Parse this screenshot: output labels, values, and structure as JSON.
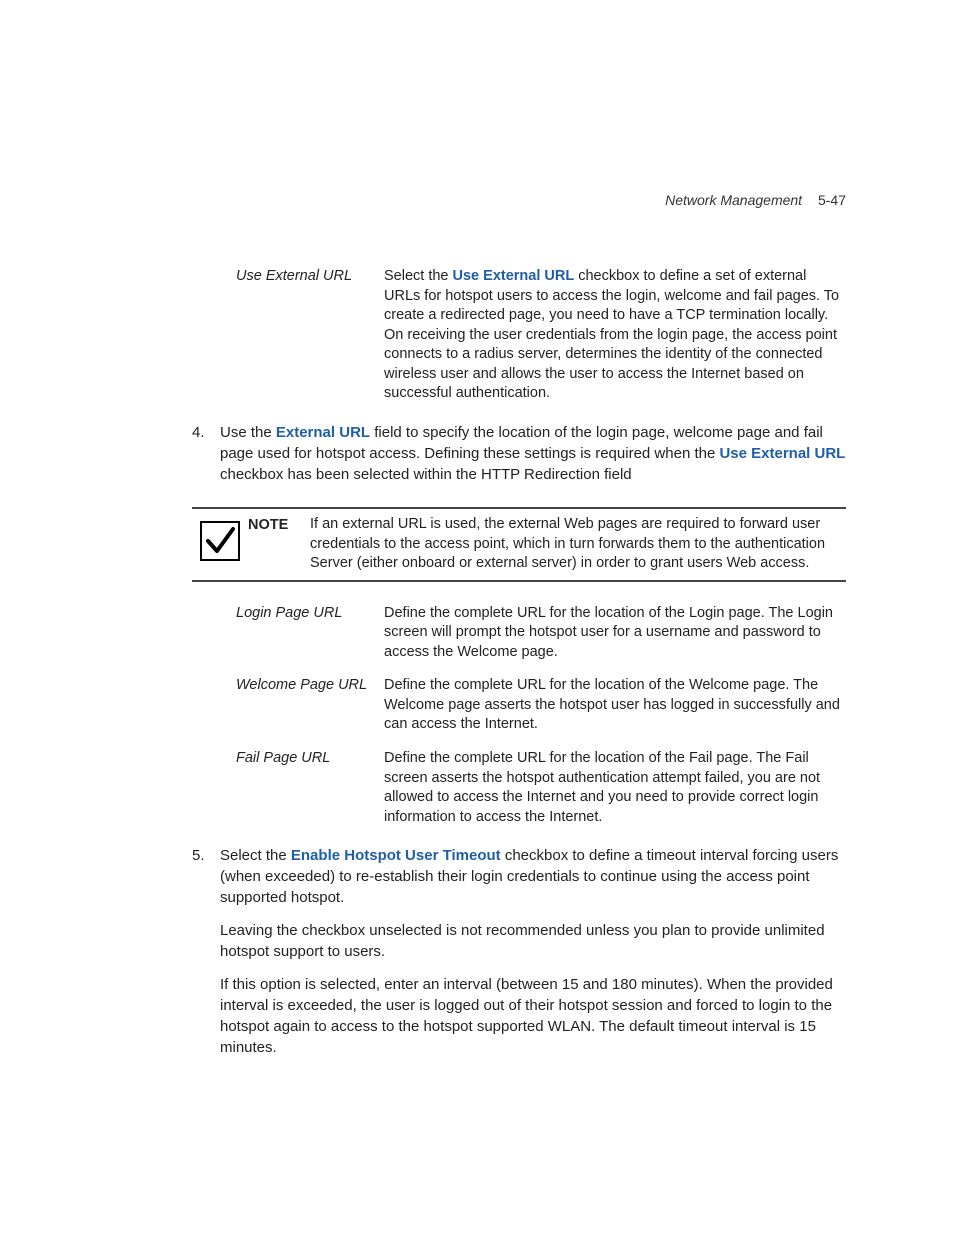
{
  "header": {
    "section": "Network Management",
    "page": "5-47"
  },
  "def1": {
    "term": "Use External URL",
    "desc_pre": "Select the ",
    "desc_bold": "Use External URL",
    "desc_post": " checkbox to define a set of external URLs for hotspot users to access the login, welcome and fail pages. To create a redirected page, you need to have a TCP termination locally. On receiving the user credentials from the login page, the access point connects to a radius server, determines the identity of the connected wireless user and allows the user to access the Internet based on successful authentication."
  },
  "step4": {
    "num": "4.",
    "t1": "Use the ",
    "b1": "External URL",
    "t2": " field to specify the location of the login page, welcome page and fail page used for hotspot access. Defining these settings is required when the ",
    "b2": "Use External URL",
    "t3": " checkbox has been selected within the HTTP Redirection field"
  },
  "note": {
    "label": "NOTE",
    "text": "If an external URL is used, the external Web pages are required to forward user credentials to the access point, which in turn forwards them to the authentication Server (either onboard or external server) in order to grant users Web access."
  },
  "defs2": [
    {
      "term": "Login Page URL",
      "desc": "Define the complete URL for the location of the Login page. The Login screen will prompt the hotspot user for a username and password to access the Welcome page."
    },
    {
      "term": "Welcome Page URL",
      "desc": "Define the complete URL for the location of the Welcome page. The Welcome page asserts the hotspot user has logged in successfully and can access the Internet."
    },
    {
      "term": "Fail Page URL",
      "desc": "Define the complete URL for the location of the Fail page. The Fail screen asserts the hotspot authentication attempt failed, you are not allowed to access the Internet and you need to provide correct login information to access the Internet."
    }
  ],
  "step5": {
    "num": "5.",
    "p1_t1": "Select the ",
    "p1_b1": "Enable Hotspot User Timeout",
    "p1_t2": " checkbox to define a timeout interval forcing users (when exceeded) to re-establish their login credentials to continue using the access point supported hotspot.",
    "p2": "Leaving the checkbox unselected is not recommended unless you plan to provide unlimited hotspot support to users.",
    "p3": "If this option is selected, enter an interval (between 15 and 180 minutes). When the provided interval is exceeded, the user is logged out of their hotspot session and forced to login to the hotspot again to access to the hotspot supported WLAN. The default timeout interval is 15 minutes."
  }
}
